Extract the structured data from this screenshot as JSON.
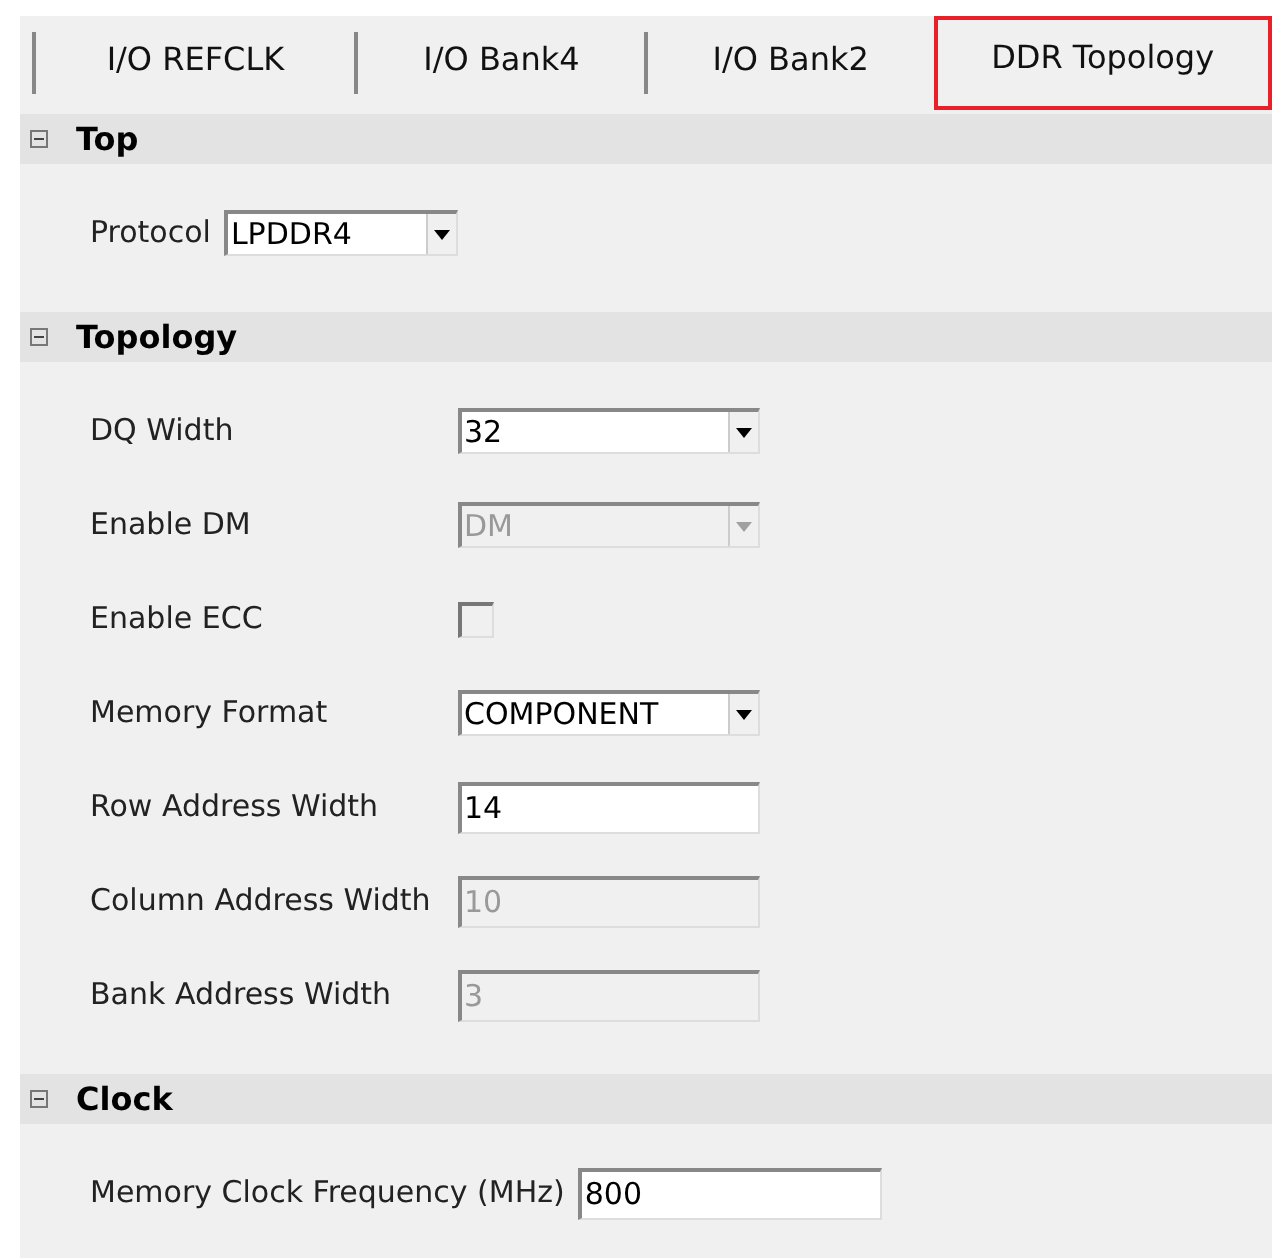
{
  "tabs": [
    {
      "label": "I/O REFCLK",
      "selected": false
    },
    {
      "label": "I/O Bank4",
      "selected": false
    },
    {
      "label": "I/O Bank2",
      "selected": false
    },
    {
      "label": "DDR Topology",
      "selected": true
    }
  ],
  "sections": [
    {
      "title": "Top",
      "expanded": true,
      "fields": [
        {
          "label": "Protocol",
          "kind": "combo",
          "value": "LPDDR4",
          "disabled": false
        }
      ]
    },
    {
      "title": "Topology",
      "expanded": true,
      "fields": [
        {
          "label": "DQ Width",
          "kind": "combo",
          "value": "32",
          "disabled": false
        },
        {
          "label": "Enable DM",
          "kind": "combo",
          "value": "DM",
          "disabled": true
        },
        {
          "label": "Enable ECC",
          "kind": "checkbox",
          "checked": false
        },
        {
          "label": "Memory Format",
          "kind": "combo",
          "value": "COMPONENT",
          "disabled": false
        },
        {
          "label": "Row Address Width",
          "kind": "text",
          "value": "14",
          "disabled": false
        },
        {
          "label": "Column Address Width",
          "kind": "text",
          "value": "10",
          "disabled": true
        },
        {
          "label": "Bank Address Width",
          "kind": "text",
          "value": "3",
          "disabled": true
        }
      ]
    },
    {
      "title": "Clock",
      "expanded": true,
      "fields": [
        {
          "label": "Memory Clock Frequency (MHz)",
          "kind": "text",
          "value": "800",
          "disabled": false
        }
      ]
    }
  ]
}
